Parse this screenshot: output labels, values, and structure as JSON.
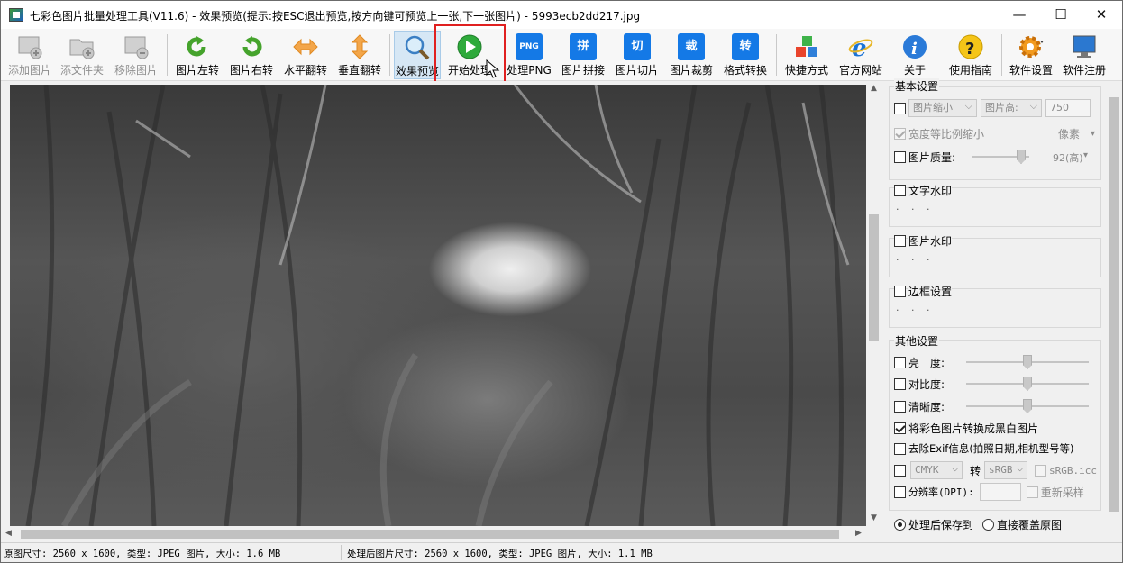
{
  "window": {
    "title": "七彩色图片批量处理工具(V11.6) - 效果预览(提示:按ESC退出预览,按方向键可预览上一张,下一张图片) - 5993ecb2dd217.jpg",
    "minimize": "—",
    "maximize": "☐",
    "close": "✕"
  },
  "toolbar": {
    "add_image": "添加图片",
    "add_folder": "添文件夹",
    "remove_image": "移除图片",
    "rotate_left": "图片左转",
    "rotate_right": "图片右转",
    "flip_horizontal": "水平翻转",
    "flip_vertical": "垂直翻转",
    "preview": "效果预览",
    "start": "开始处理",
    "png": "处理PNG",
    "png_icon": "PNG",
    "stitch": "图片拼接",
    "stitch_icon": "拼",
    "slice": "图片切片",
    "slice_icon": "切",
    "crop": "图片裁剪",
    "crop_icon": "裁",
    "convert": "格式转换",
    "convert_icon": "转",
    "shortcut": "快捷方式",
    "website": "官方网站",
    "about": "关于",
    "guide": "使用指南",
    "settings": "软件设置",
    "register": "软件注册"
  },
  "panel": {
    "basic": {
      "title": "基本设置",
      "shrink_combo": "图片缩小",
      "height_combo": "图片高:",
      "height_value": "750",
      "proportional": "宽度等比例缩小",
      "unit": "像素",
      "quality_label": "图片质量:",
      "quality_value": "92(高)",
      "quality_level": 0.92
    },
    "text_watermark": {
      "title": "文字水印",
      "dots": "· · ·"
    },
    "image_watermark": {
      "title": "图片水印",
      "dots": "· · ·"
    },
    "border": {
      "title": "边框设置",
      "dots": "· · ·"
    },
    "other": {
      "title": "其他设置",
      "brightness": "亮　度:",
      "contrast": "对比度:",
      "sharpness": "清晰度:",
      "grayscale": "将彩色图片转换成黑白图片",
      "remove_exif": "去除Exif信息(拍照日期,相机型号等)",
      "cmyk": "CMYK",
      "convert_to": "转",
      "srgb": "sRGB",
      "srgb_icc": "sRGB.icc",
      "dpi": "分辨率(DPI):",
      "resample": "重新采样"
    },
    "save": {
      "save_to": "处理后保存到",
      "overwrite": "直接覆盖原图"
    }
  },
  "status": {
    "original": "原图尺寸: 2560 x 1600, 类型: JPEG 图片, 大小: 1.6 MB",
    "processed": "处理后图片尺寸: 2560 x 1600, 类型: JPEG 图片, 大小: 1.1 MB"
  }
}
